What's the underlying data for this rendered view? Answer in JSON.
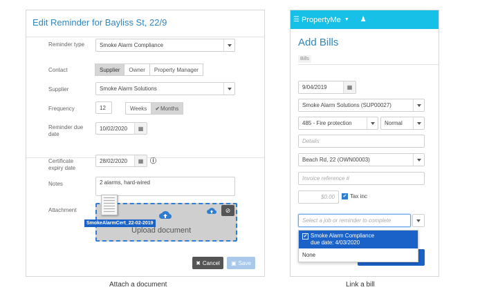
{
  "left": {
    "title": "Edit Reminder for Bayliss St, 22/9",
    "reminder_type_label": "Reminder type",
    "reminder_type_value": "Smoke Alarm Compliance",
    "contact_label": "Contact",
    "contact_options": [
      "Supplier",
      "Owner",
      "Property Manager"
    ],
    "supplier_label": "Supplier",
    "supplier_value": "Smoke Alarm Solutions",
    "frequency_label": "Frequency",
    "frequency_value": "12",
    "frequency_units": [
      "Weeks",
      "Months"
    ],
    "due_label": "Reminder due date",
    "due_value": "10/02/2020",
    "cert_label": "Certificate expiry date",
    "cert_value": "28/02/2020",
    "notes_label": "Notes",
    "notes_value": "2 alarms, hard-wired",
    "attachment_label": "Attachment",
    "upload_text": "Upload document",
    "file_tag": "SmokeAlarmCert_22-02-2019",
    "cancel_label": "Cancel",
    "save_label": "Save"
  },
  "right": {
    "brand": "PropertyMe",
    "title": "Add Bills",
    "breadcrumb": "Bills",
    "date_value": "9/04/2019",
    "supplier_value": "Smoke Alarm Solutions (SUP00027)",
    "account_value": "485 - Fire protection",
    "priority_value": "Normal",
    "details_placeholder": "Details",
    "property_value": "Beach Rd, 22 (OWN00003)",
    "invoice_placeholder": "Invoice reference #",
    "amount_placeholder": "$0.00",
    "tax_label": "Tax inc",
    "link_placeholder": "Select a job or reminder to complete",
    "dropdown_option_title": "Smoke Alarm Compliance",
    "dropdown_option_sub": "due date: 4/03/2020",
    "dropdown_option_none": "None"
  },
  "captions": {
    "left": "Attach a document",
    "right": "Link a bill"
  },
  "colors": {
    "accent_blue": "#2e86c1",
    "nav_cyan": "#17c0e7",
    "selection_blue": "#1a62c8"
  },
  "icons": [
    "calendar-icon",
    "info-icon",
    "cloud-upload-icon",
    "paperclip-icon",
    "menu-icon",
    "user-icon",
    "checkbox-icon"
  ]
}
